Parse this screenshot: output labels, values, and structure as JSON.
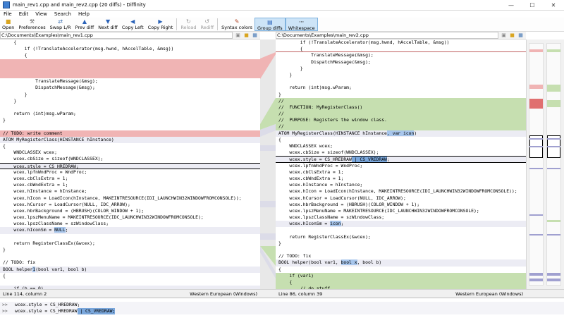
{
  "window": {
    "title": "main_rev1.cpp and main_rev2.cpp (20 diffs) - Diffinity",
    "min": "—",
    "max": "☐",
    "close": "✕"
  },
  "menu": [
    "File",
    "Edit",
    "View",
    "Search",
    "Help"
  ],
  "toolbar": {
    "open": "Open",
    "preferences": "Preferences",
    "swap": "Swap L/R",
    "prev_diff": "Prev diff",
    "next_diff": "Next diff",
    "copy_left": "Copy Left",
    "copy_right": "Copy Right",
    "reload": "Reload",
    "rediff": "Rediff",
    "syntax": "Syntax colors",
    "group": "Group diffs",
    "whitespace": "Whitespace"
  },
  "left": {
    "path": "C:\\Documents\\Examples\\main_rev1.cpp",
    "status_pos": "Line 114, column 2",
    "status_enc": "Western European (Windows)"
  },
  "right": {
    "path": "C:\\Documents\\Examples\\main_rev2.cpp",
    "status_pos": "Line 86, column 39",
    "status_enc": "Western European (Windows)"
  },
  "bottom": {
    "line1": "wcex.style = CS_HREDRAW;",
    "line2a": "wcex.style = CS_HREDRAW",
    "line2b": " | CS_VREDRAW;",
    "marker": ">>"
  }
}
